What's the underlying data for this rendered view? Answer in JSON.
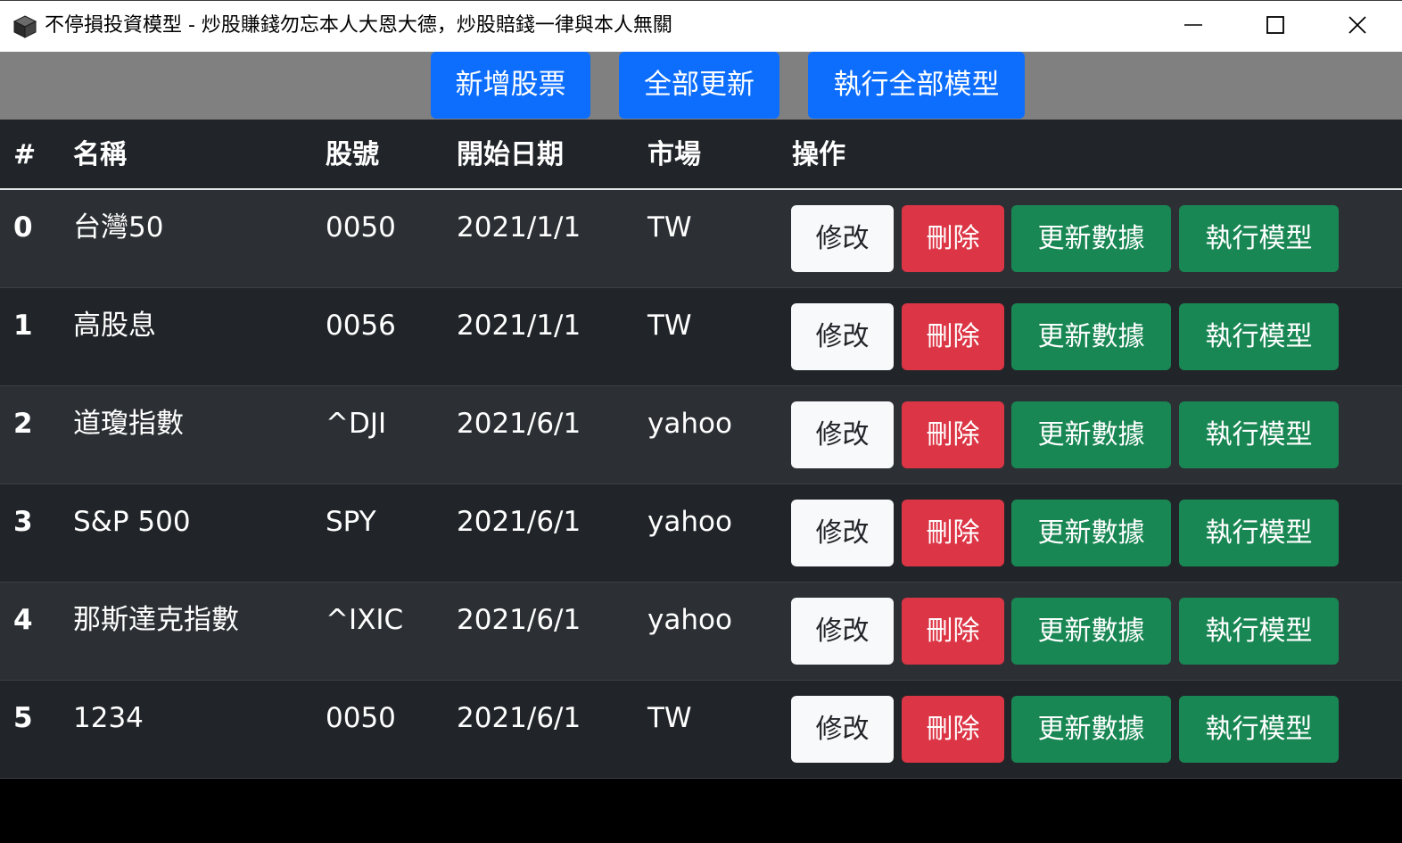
{
  "window": {
    "title": "不停損投資模型 - 炒股賺錢勿忘本人大恩大德，炒股賠錢一律與本人無關",
    "app_icon": "cube-icon",
    "controls": [
      "minimize-icon",
      "maximize-icon",
      "close-icon"
    ]
  },
  "toolbar": {
    "add_stock": "新增股票",
    "update_all": "全部更新",
    "run_all_models": "執行全部模型"
  },
  "table": {
    "headers": [
      "#",
      "名稱",
      "股號",
      "開始日期",
      "市場",
      "操作"
    ],
    "rows": [
      {
        "index": "0",
        "name": "台灣50",
        "code": "0050",
        "start_date": "2021/1/1",
        "market": "TW"
      },
      {
        "index": "1",
        "name": "高股息",
        "code": "0056",
        "start_date": "2021/1/1",
        "market": "TW"
      },
      {
        "index": "2",
        "name": "道瓊指數",
        "code": "^DJI",
        "start_date": "2021/6/1",
        "market": "yahoo"
      },
      {
        "index": "3",
        "name": "S&P 500",
        "code": "SPY",
        "start_date": "2021/6/1",
        "market": "yahoo"
      },
      {
        "index": "4",
        "name": "那斯達克指數",
        "code": "^IXIC",
        "start_date": "2021/6/1",
        "market": "yahoo"
      },
      {
        "index": "5",
        "name": "1234",
        "code": "0050",
        "start_date": "2021/6/1",
        "market": "TW"
      }
    ],
    "actions": {
      "edit": "修改",
      "delete": "刪除",
      "update_data": "更新數據",
      "run_model": "執行模型"
    }
  },
  "colors": {
    "primary": "#0d6efd",
    "danger": "#dc3545",
    "success": "#198754",
    "light": "#f8f9fa",
    "table_dark": "#212529",
    "table_stripe": "#2c3034",
    "toolbar_bg": "#808080"
  }
}
